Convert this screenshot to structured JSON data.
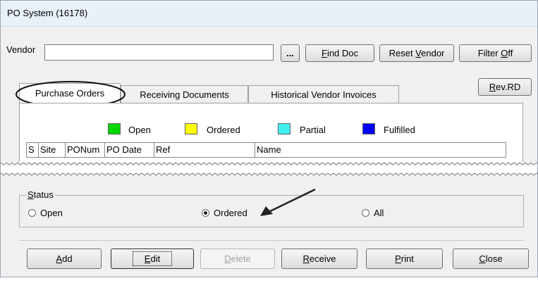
{
  "window": {
    "title": "PO System (16178)"
  },
  "vendor": {
    "label": "Vendor",
    "value": ""
  },
  "toolbar": {
    "browse_label": "...",
    "find_doc": {
      "pre": "",
      "acc": "F",
      "post": "ind Doc"
    },
    "reset_vendor": {
      "pre": "Reset ",
      "acc": "V",
      "post": "endor"
    },
    "filter": {
      "pre": "Filter ",
      "acc": "O",
      "post": "ff"
    },
    "rev_rd": {
      "pre": "",
      "acc": "R",
      "post": "ev.RD"
    }
  },
  "tabs": [
    {
      "label": "Purchase Orders"
    },
    {
      "label": "Receiving Documents"
    },
    {
      "label": "Historical Vendor Invoices"
    }
  ],
  "legend": [
    {
      "label": "Open",
      "color": "#00d800"
    },
    {
      "label": "Ordered",
      "color": "#ffff00"
    },
    {
      "label": "Partial",
      "color": "#40f0f0"
    },
    {
      "label": "Fulfilled",
      "color": "#0000ff"
    }
  ],
  "grid": {
    "columns": [
      "S",
      "Site",
      "PONum",
      "PO Date",
      "Ref",
      "Name"
    ]
  },
  "status": {
    "label_acc": "S",
    "label_rest": "tatus",
    "options": [
      {
        "label": "Open",
        "checked": false
      },
      {
        "label": "Ordered",
        "checked": true
      },
      {
        "label": "All",
        "checked": false
      }
    ]
  },
  "actions": {
    "add": {
      "pre": "",
      "acc": "A",
      "post": "dd"
    },
    "edit": {
      "pre": "",
      "acc": "E",
      "post": "dit"
    },
    "delete": {
      "pre": "",
      "acc": "D",
      "post": "elete"
    },
    "receive": {
      "pre": "",
      "acc": "R",
      "post": "eceive"
    },
    "print": {
      "pre": "",
      "acc": "P",
      "post": "rint"
    },
    "close": {
      "pre": "",
      "acc": "C",
      "post": "lose"
    }
  }
}
